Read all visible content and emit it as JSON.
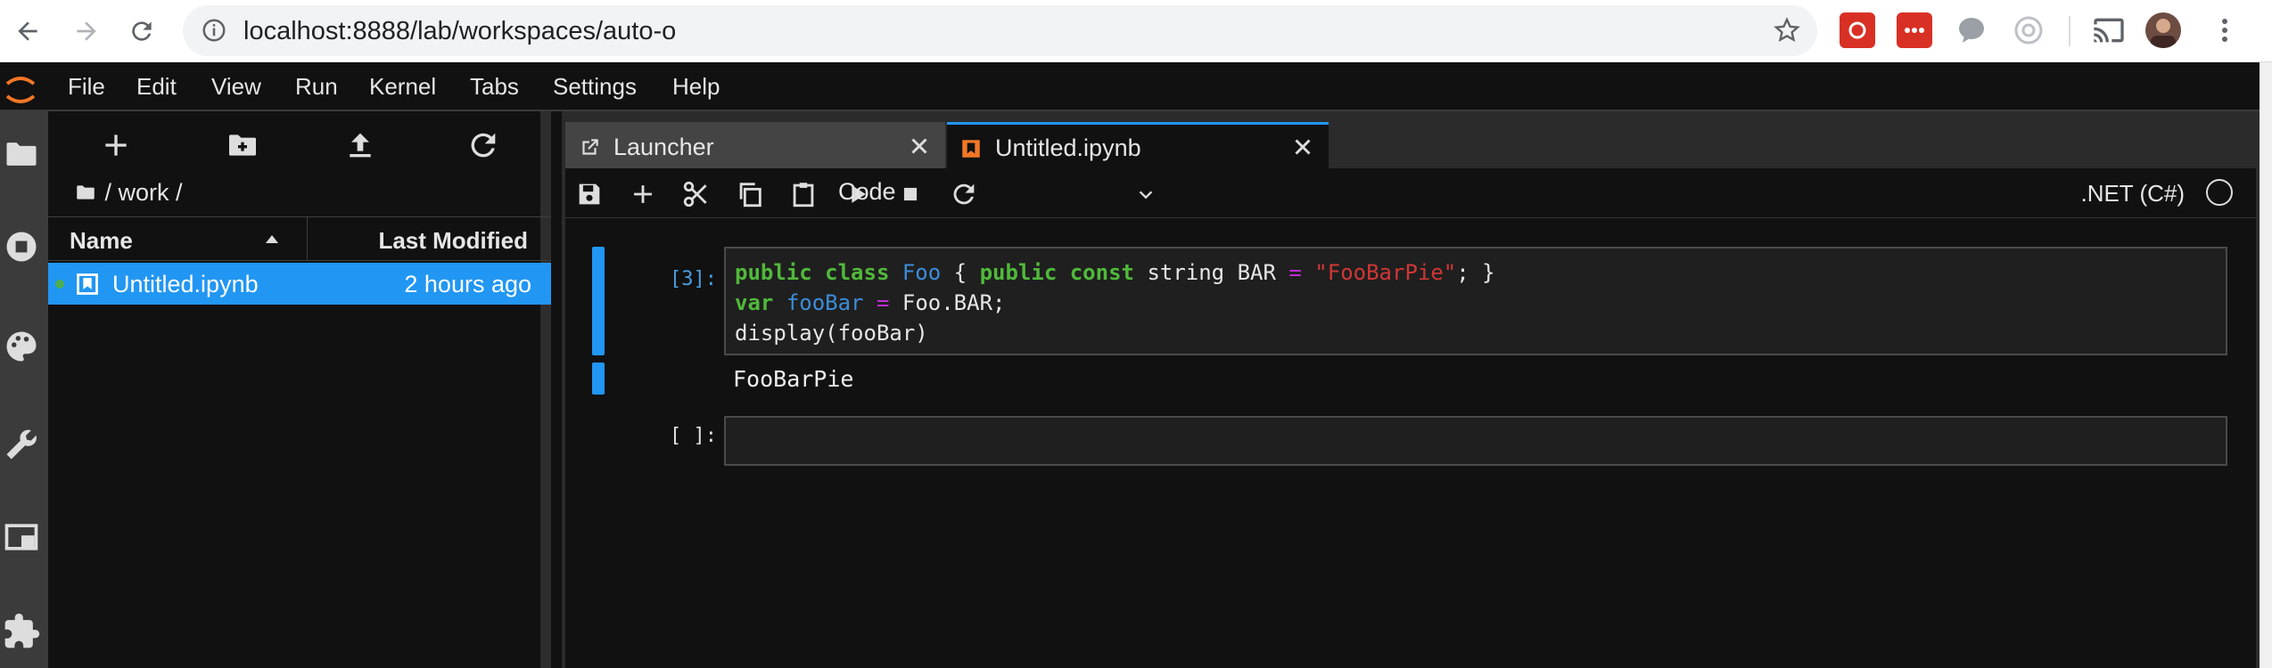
{
  "browser": {
    "url": "localhost:8888/lab/workspaces/auto-o"
  },
  "menu": [
    "File",
    "Edit",
    "View",
    "Run",
    "Kernel",
    "Tabs",
    "Settings",
    "Help"
  ],
  "filebrowser": {
    "breadcrumb": "/ work /",
    "col_name": "Name",
    "col_modified": "Last Modified",
    "rows": [
      {
        "name": "Untitled.ipynb",
        "modified": "2 hours ago"
      }
    ]
  },
  "tabs": [
    {
      "label": "Launcher"
    },
    {
      "label": "Untitled.ipynb"
    }
  ],
  "toolbar": {
    "cell_type": "Code",
    "kernel": ".NET (C#)"
  },
  "cells": [
    {
      "prompt": "[3]:",
      "output": "FooBarPie"
    },
    {
      "prompt": "[ ]:"
    }
  ],
  "code_tokens": {
    "line1": [
      "public",
      "class",
      "Foo",
      "{",
      "public",
      "const",
      "string BAR",
      "=",
      "\"FooBarPie\"",
      "; }"
    ],
    "line2": [
      "var",
      "fooBar",
      "=",
      "Foo.BAR;"
    ],
    "line3": "display(fooBar)"
  }
}
